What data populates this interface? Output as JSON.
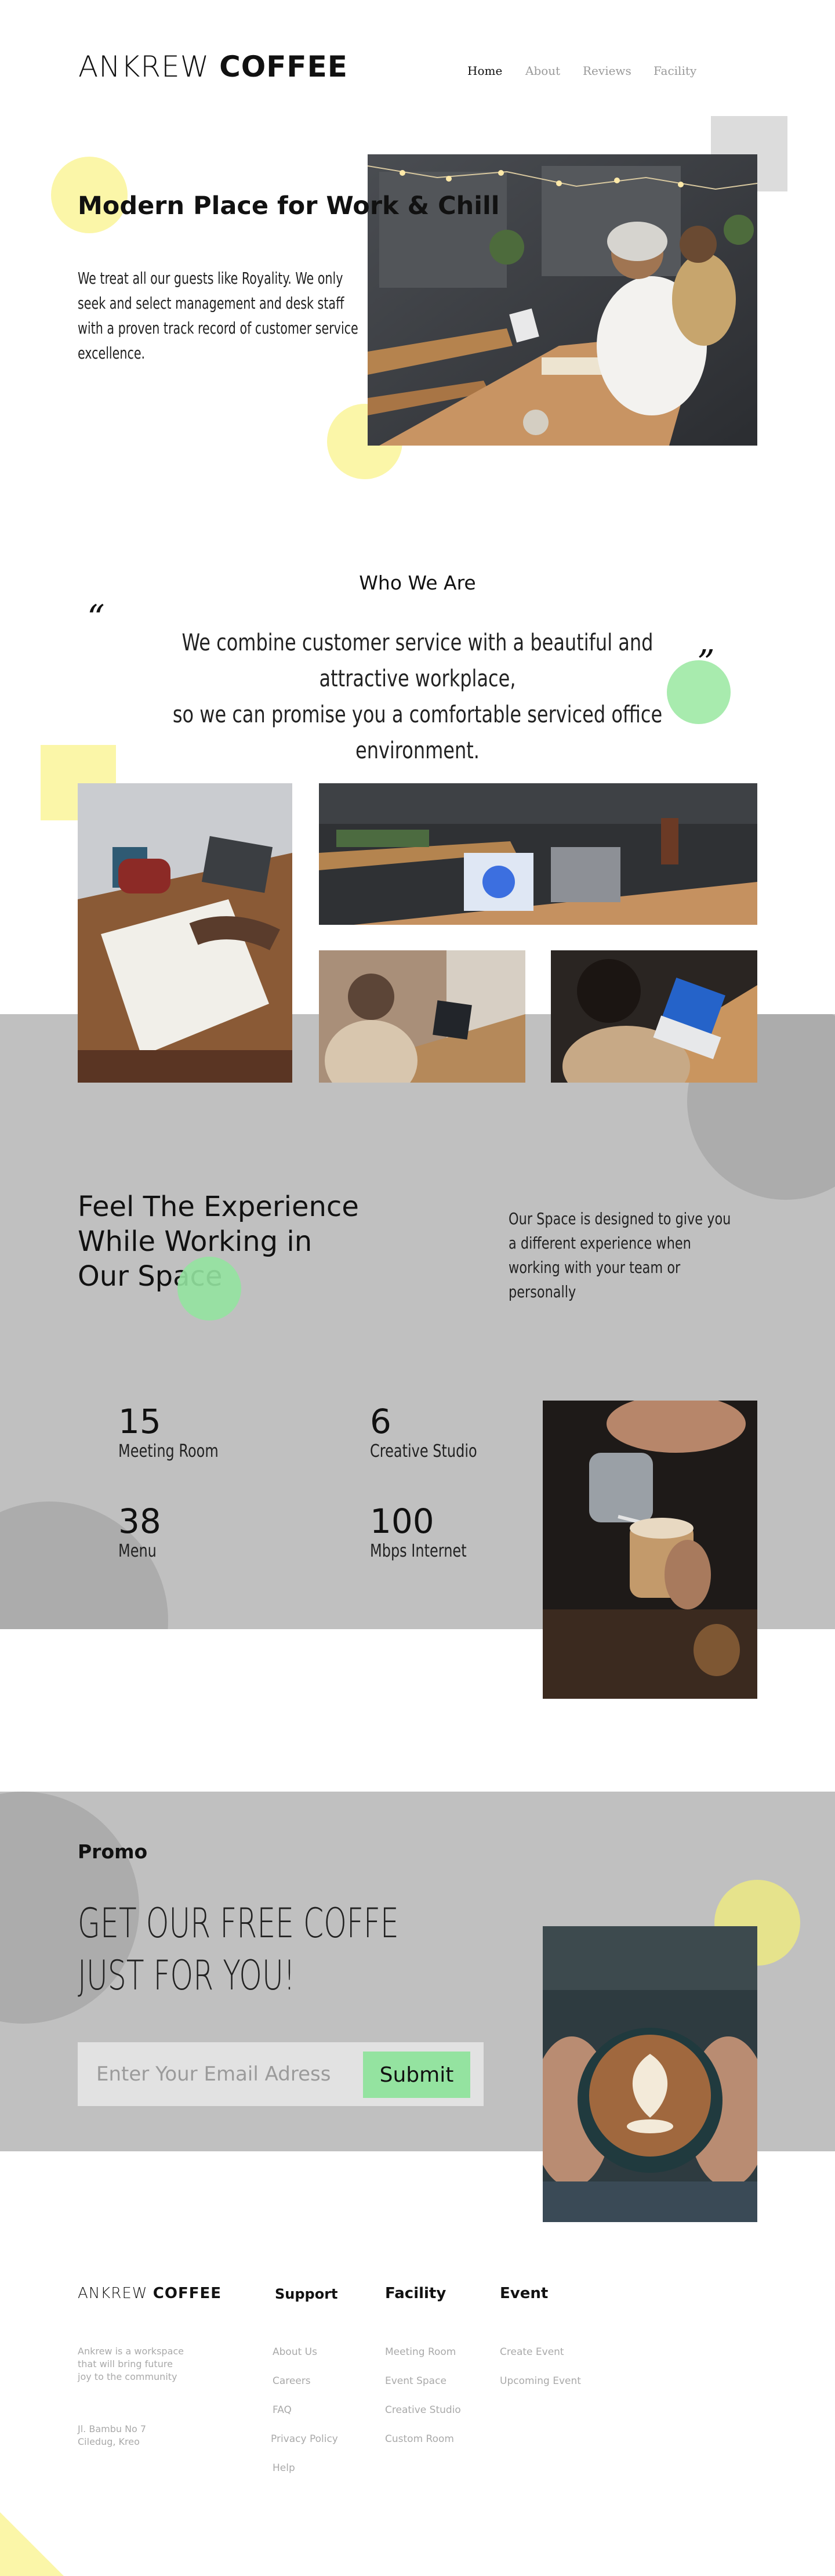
{
  "header": {
    "logo_light": "ANKREW",
    "logo_bold": "COFFEE",
    "nav": [
      "Home",
      "About",
      "Reviews",
      "Facility"
    ],
    "active_nav": "Home"
  },
  "hero": {
    "title": "Modern Place for Work & Chill",
    "text": "We treat all our guests like Royality. We only seek and select management and desk staff with a proven track record of customer service excellence.",
    "image": "people-working-at-cafe-table-photo"
  },
  "about": {
    "title": "Who We Are",
    "open_quote": "“",
    "close_quote": "”",
    "quote_line1": "We combine customer service with a beautiful and attractive workplace,",
    "quote_line2": "so we can promise you a comfortable serviced office environment."
  },
  "gallery": {
    "images": [
      "drawing-on-desk-photo",
      "laptops-on-table-photo",
      "man-with-laptop-photo",
      "woman-with-tablet-photo"
    ]
  },
  "feel": {
    "title_line1": "Feel The Experience",
    "title_line2": "While Working in",
    "title_line3": "Our Space",
    "text": "Our Space is designed to give you a different experience when working with your team or personally",
    "stats": [
      {
        "value": "15",
        "label": "Meeting Room"
      },
      {
        "value": "6",
        "label": "Creative Studio"
      },
      {
        "value": "38",
        "label": "Menu"
      },
      {
        "value": "100",
        "label": "Mbps Internet"
      }
    ],
    "image": "barista-pouring-latte-photo"
  },
  "promo": {
    "label": "Promo",
    "title_line1": "GET OUR FREE COFFE",
    "title_line2": "JUST FOR YOU!",
    "email_placeholder": "Enter Your Email Adress",
    "submit_label": "Submit",
    "image": "hands-holding-latte-photo"
  },
  "footer": {
    "logo_light": "ANKREW",
    "logo_bold": "COFFEE",
    "about_line1": "Ankrew is a workspace",
    "about_line2": "that will bring future",
    "about_line3": "joy to the community",
    "address_line1": "Jl. Bambu No 7",
    "address_line2": "Ciledug, Kreo",
    "support": {
      "title": "Support",
      "items": [
        "About Us",
        "Careers",
        "FAQ",
        "Privacy Policy",
        "Help"
      ]
    },
    "facility": {
      "title": "Facility",
      "items": [
        "Meeting Room",
        "Event Space",
        "Creative Studio",
        "Custom Room"
      ]
    },
    "event": {
      "title": "Event",
      "items": [
        "Create Event",
        "Upcoming Event"
      ]
    }
  },
  "colors": {
    "yellow": "#fbf6a8",
    "green": "#a8ebae",
    "gray_band": "#c0c0c0",
    "gray_circle": "#acacac",
    "submit": "#94e3a0"
  }
}
